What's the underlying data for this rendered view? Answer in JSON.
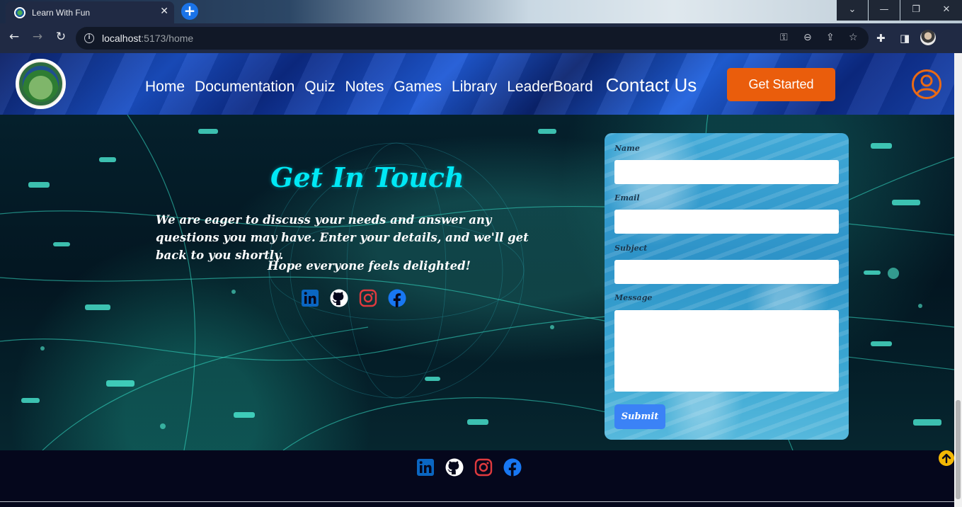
{
  "browser": {
    "tab_title": "Learn With Fun",
    "tab_close": "✕",
    "new_tab": "+",
    "url_host": "localhost",
    "url_rest": ":5173/home",
    "window_controls": [
      "⌄",
      "—",
      "❐",
      "✕"
    ]
  },
  "header": {
    "nav": [
      {
        "label": "Home"
      },
      {
        "label": "Documentation"
      },
      {
        "label": "Quiz"
      },
      {
        "label": "Notes"
      },
      {
        "label": "Games"
      },
      {
        "label": "Library"
      },
      {
        "label": "LeaderBoard"
      },
      {
        "label": "Contact Us"
      }
    ],
    "cta_label": "Get Started"
  },
  "contact": {
    "title": "Get In Touch",
    "description": "We are eager to discuss your needs and answer any questions you may have. Enter your details, and we'll get back to you shortly.",
    "closing": "Hope everyone feels delighted!",
    "socials": [
      "linkedin-icon",
      "github-icon",
      "instagram-icon",
      "facebook-icon"
    ],
    "form": {
      "name_label": "Name",
      "email_label": "Email",
      "subject_label": "Subject",
      "message_label": "Message",
      "submit_label": "Submit"
    }
  },
  "colors": {
    "accent_cyan": "#00e8f5",
    "cta_orange": "#ea5d0c",
    "submit_blue": "#3b82f6",
    "linkedin": "#0a66c2",
    "instagram": "#e03a3e",
    "facebook": "#1877f2"
  }
}
